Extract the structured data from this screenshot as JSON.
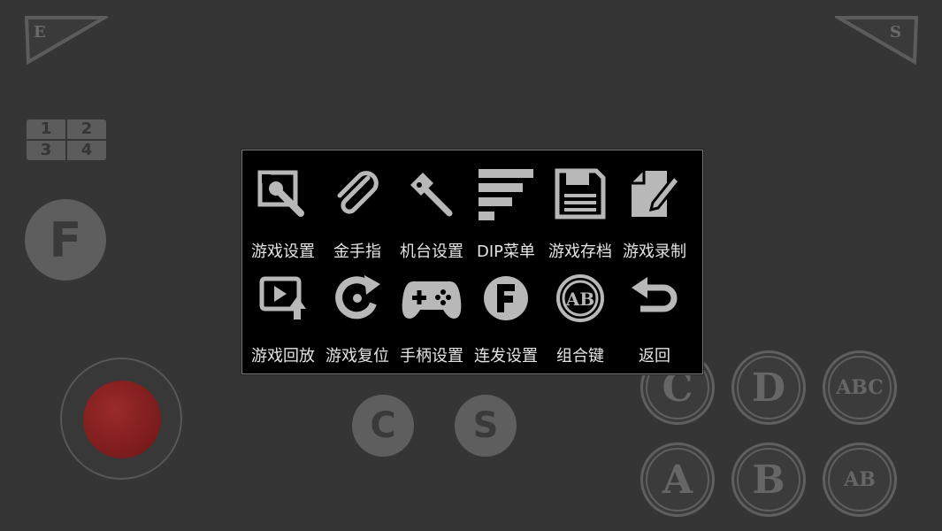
{
  "overlay": {
    "top_left_label": "E",
    "top_right_label": "S",
    "player_digits": [
      "1",
      "2",
      "3",
      "4"
    ],
    "fire_label": "F",
    "coin_label": "C",
    "start_label": "S",
    "buttons": {
      "c": "C",
      "d": "D",
      "abc": "ABC",
      "a": "A",
      "b": "B",
      "ab": "AB"
    }
  },
  "menu": {
    "items": [
      {
        "label": "游戏设置",
        "icon": "wrench-settings-icon"
      },
      {
        "label": "金手指",
        "icon": "paperclip-icon"
      },
      {
        "label": "机台设置",
        "icon": "hammer-icon"
      },
      {
        "label": "DIP菜单",
        "icon": "dip-bars-icon"
      },
      {
        "label": "游戏存档",
        "icon": "floppy-disk-icon"
      },
      {
        "label": "游戏录制",
        "icon": "pencil-note-icon"
      },
      {
        "label": "游戏回放",
        "icon": "video-replay-icon"
      },
      {
        "label": "游戏复位",
        "icon": "reset-arrow-icon"
      },
      {
        "label": "手柄设置",
        "icon": "gamepad-icon"
      },
      {
        "label": "连发设置",
        "icon": "turbo-f-icon"
      },
      {
        "label": "组合键",
        "icon": "ab-combo-icon"
      },
      {
        "label": "返回",
        "icon": "return-arrow-icon"
      }
    ]
  },
  "colors": {
    "background": "#353535",
    "menu_background": "#000000",
    "icon_color": "#b8b8b8",
    "label_color": "#e4e4e4",
    "joystick_red": "#8a1f1f"
  }
}
